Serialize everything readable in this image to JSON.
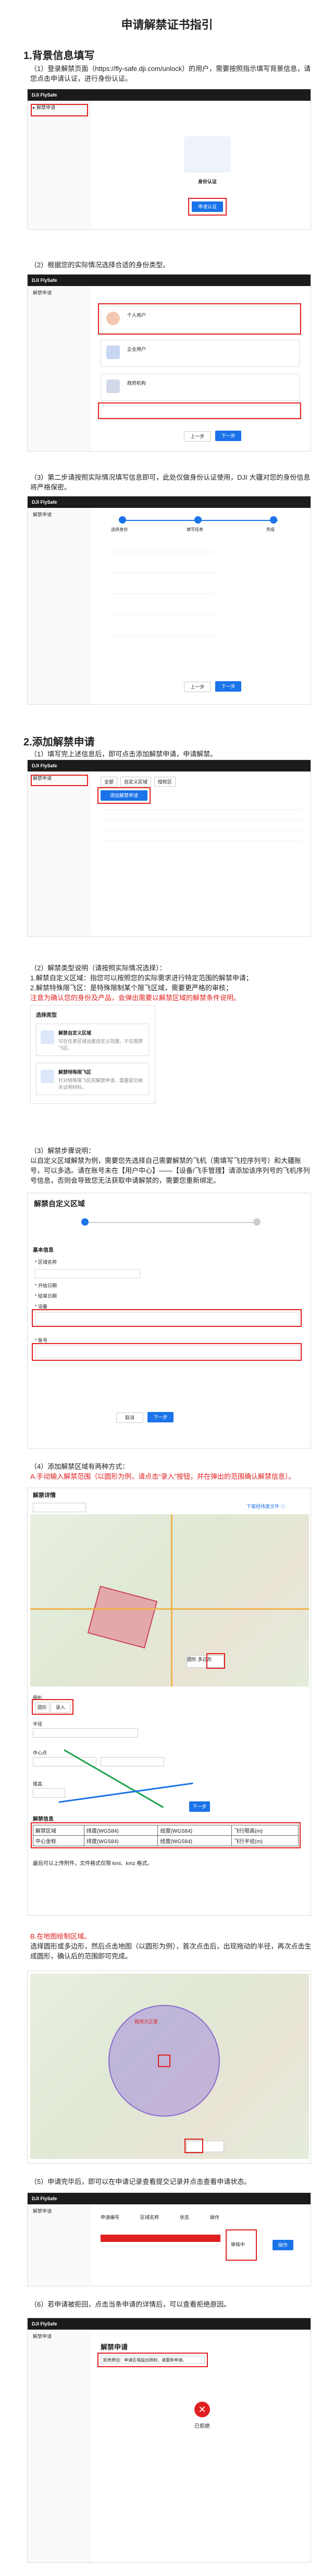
{
  "title": "申请解禁证书指引",
  "section1": {
    "heading": "1.背景信息填写",
    "step1": "（1）登录解禁页面（https://fly-safe.dji.com/unlock）的用户，需要按照指示填写背景信息，请您点击申请认证，进行身份认证。",
    "step2": "（2）根据您的实际情况选择合适的身份类型。",
    "step3": "（3）第二步请按照实际情况填写信息即可，此处仅做身份认证使用，DJI 大疆对您的身份信息将严格保密。",
    "brand": "DJI FlySafe",
    "apply_btn": "申请认证",
    "auth_title": "身份认证",
    "type_options": [
      "个人用户",
      "企业用户",
      "政府机构"
    ],
    "next_btn": "下一步",
    "prev_btn": "上一步",
    "step_labels": [
      "选择身份",
      "填写信息",
      "完成"
    ]
  },
  "section2": {
    "heading": "2.添加解禁申请",
    "step1": "（1）填写完上述信息后，即可点击添加解禁申请，申请解禁。",
    "add_btn": "添加解禁申请",
    "tabs": [
      "全部",
      "自定义区域",
      "授权区"
    ],
    "step2_a": "（2）解禁类型说明（请按照实际情况选择）：",
    "step2_b": "1.解禁自定义区域：指您可以按照您的实际需求进行特定范围的解禁申请；",
    "step2_c": "2.解禁特殊限飞区：是特殊限制某个限飞区域，需要更严格的审核；",
    "step2_d": "注意为确认您的身份及产品，会弹出需要以解禁区域的解禁条件说明。",
    "choice_title": "选择类型",
    "choice_opts": [
      "解禁自定义区域",
      "解禁特殊限飞区"
    ],
    "choice_desc": [
      "可在任意区域设置自定义范围，不仅限禁飞区。",
      "针对特殊限飞区的解禁申请，需要提交相关证明材料。"
    ],
    "step3_a": "（3）解禁步骤说明：",
    "step3_b": "以自定义区域解禁为例，需要您先选择自己需要解禁的飞机（需填写飞控序列号）和大疆账号，可以多选。请在账号未在【用户中心】——【设备/飞手管理】请添加该序列号的飞机序列号信息，否则会导致您无法获取申请解禁的，需要您重新绑定。",
    "unlock_area_title": "解禁自定义区域",
    "basic_info": "基本信息",
    "field_labels": [
      "* 区域名称",
      "* 开始日期",
      "* 结束日期",
      "* 设备",
      "* 账号"
    ],
    "cancel_btn": "取消",
    "next_btn": "下一步",
    "step4_a": "（4）添加解禁区域有两种方式：",
    "step4_b": "A.手动输入解禁范围（以圆形为例，请点击“录入”按钮，并在弹出的范围确认解禁信息）。",
    "unlock_detail": "解禁详情",
    "polygon_hint": "下载经纬度文件 ⓘ",
    "shape_labels": [
      "圆形",
      "多边形"
    ],
    "enter_btn": "录入",
    "radius_label": "半径",
    "center_label": "中心点",
    "height_label": "限高",
    "table_title": "解禁信息",
    "table_rows": [
      [
        "解禁区域",
        "纬度(WGS84)",
        "经度(WGS84)",
        "飞行限高(m)"
      ],
      [
        "中心坐标",
        "纬度(WGS84)",
        "经度(WGS84)",
        "飞行半径(m)"
      ]
    ],
    "draw_note": "最后可以上传附件，文件格式仅限 kml、kmz 格式。",
    "step4_c": "B.在地图绘制区域。",
    "step4_d": "选择圆形或多边形，然后点击地图（以圆形为例），首次点击后，出现拖动的半径，再次点击生成圆形，确认后的范围即可完成。",
    "step5": "（5）申请完毕后，即可以在申请记录查看提交记录并点击查看申请状态。",
    "step6": "（6）若申请被拒回，点击当条申请的详情后，可以查看拒绝原因。",
    "record_title": "解禁申请",
    "rejected_label": "已拒绝",
    "reject_reason": "拒绝原因：申请区域超出限制，请重新申请。",
    "record_cols": [
      "申请编号",
      "区域名称",
      "状态",
      "操作"
    ],
    "record_status": "审核中",
    "map_region_label": "我用方正里"
  }
}
